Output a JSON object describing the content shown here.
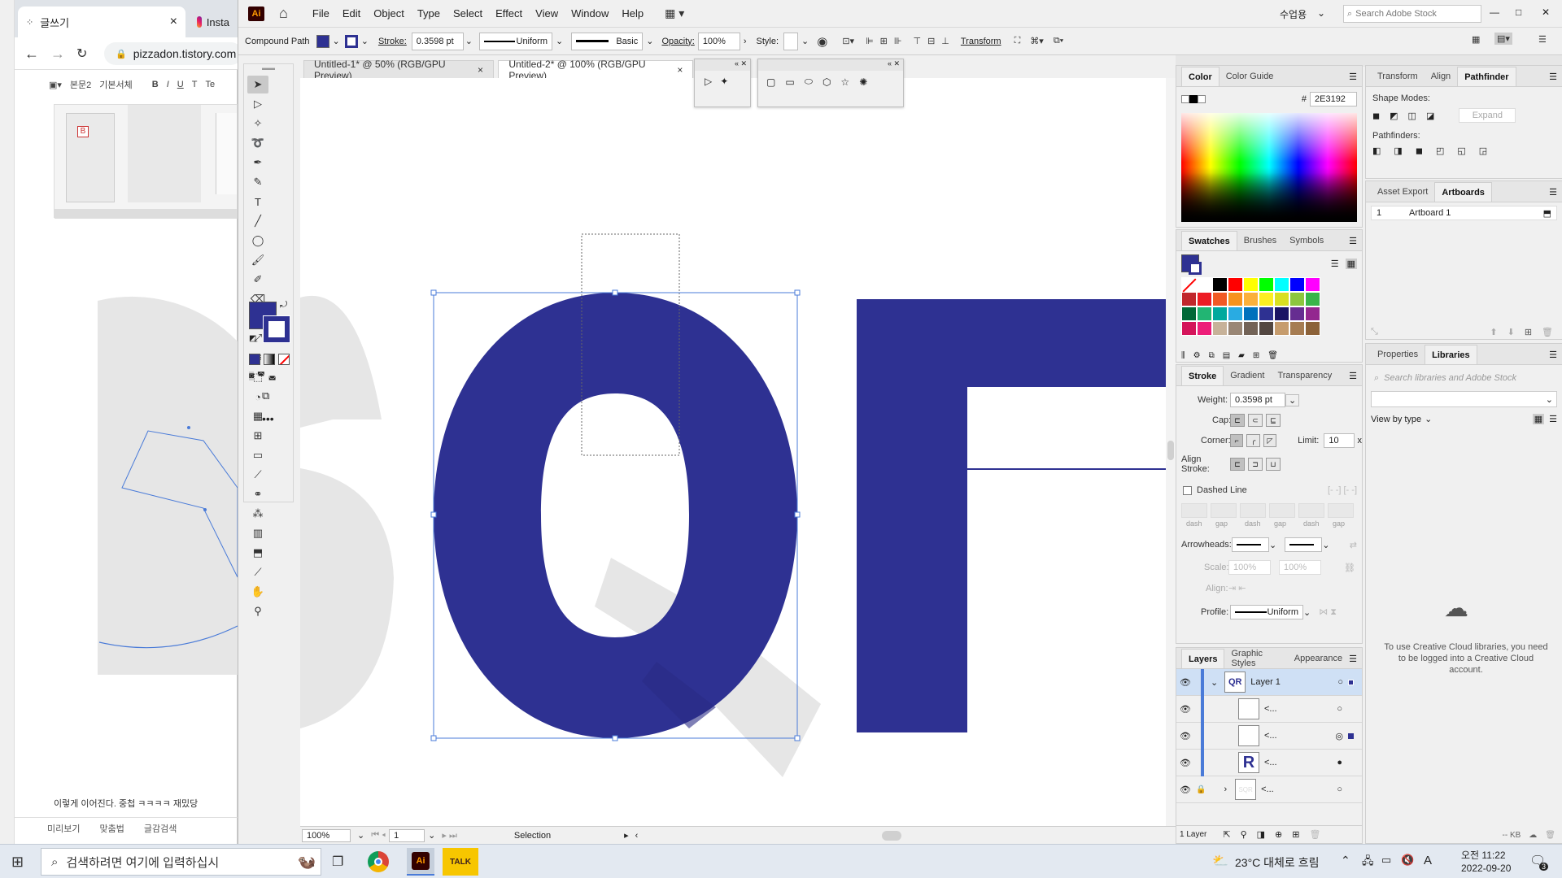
{
  "browser": {
    "tabs": [
      {
        "label": "글쓰기",
        "close": "×"
      },
      {
        "label": "Insta"
      }
    ],
    "url": "pizzadon.tistory.com",
    "editor_toolbar": [
      "본문2",
      "기본서체",
      "B",
      "I",
      "U",
      "T",
      "Te"
    ],
    "caption": "이렇게 이어진다. 중첩 ㅋㅋㅋㅋ 재밌당",
    "bottom_buttons": [
      "미리보기",
      "맞춤법",
      "글감검색"
    ]
  },
  "ai": {
    "logo": "Ai",
    "menu": [
      "File",
      "Edit",
      "Object",
      "Type",
      "Select",
      "Effect",
      "View",
      "Window",
      "Help"
    ],
    "user": "수업용",
    "stock_search_placeholder": "Search Adobe Stock",
    "window_controls": [
      "—",
      "□",
      "✕"
    ],
    "control": {
      "selection_type": "Compound Path",
      "stroke_label": "Stroke:",
      "stroke_weight": "0.3598 pt",
      "stroke_profile": "Uniform",
      "brush": "Basic",
      "opacity_label": "Opacity:",
      "opacity": "100%",
      "style_label": "Style:",
      "transform": "Transform"
    },
    "doc_tabs": [
      {
        "label": "Untitled-1* @ 50% (RGB/GPU Preview)",
        "active": false
      },
      {
        "label": "Untitled-2* @ 100% (RGB/GPU Preview)",
        "active": true
      }
    ],
    "fill_color": "#2E3192",
    "status": {
      "zoom": "100%",
      "artboard": "1",
      "tool": "Selection"
    }
  },
  "panels": {
    "color_tabs": [
      "Color",
      "Color Guide"
    ],
    "hex_label": "#",
    "hex": "2E3192",
    "swatch_tabs": [
      "Swatches",
      "Brushes",
      "Symbols"
    ],
    "swatches": [
      "#ffffff",
      "#ffffff",
      "#000000",
      "#ff0000",
      "#ffff00",
      "#00ff00",
      "#00ffff",
      "#0000ff",
      "#ff00ff",
      "#c1272d",
      "#ed1c24",
      "#f15a24",
      "#f7931e",
      "#fbb03b",
      "#fcee21",
      "#d9e021",
      "#8cc63f",
      "#39b54a",
      "#006837",
      "#22b573",
      "#00a99d",
      "#29abe2",
      "#0071bc",
      "#2e3192",
      "#1b1464",
      "#662d91",
      "#93278f",
      "#d4145a",
      "#ed1e79",
      "#c7b299",
      "#998675",
      "#736357",
      "#534741",
      "#c69c6d",
      "#a67c52",
      "#8c6239"
    ],
    "stroke_tabs": [
      "Stroke",
      "Gradient",
      "Transparency"
    ],
    "stroke": {
      "weight_label": "Weight:",
      "weight": "0.3598 pt",
      "cap_label": "Cap:",
      "corner_label": "Corner:",
      "limit_label": "Limit:",
      "limit": "10",
      "limit_x": "x",
      "align_label": "Align Stroke:",
      "dashed_label": "Dashed Line",
      "dash_labels": [
        "dash",
        "gap",
        "dash",
        "gap",
        "dash",
        "gap"
      ],
      "arrowheads_label": "Arrowheads:",
      "scale_label": "Scale:",
      "scale1": "100%",
      "scale2": "100%",
      "align2_label": "Align:",
      "profile_label": "Profile:",
      "profile": "Uniform"
    },
    "layers_tabs": [
      "Layers",
      "Graphic Styles",
      "Appearance"
    ],
    "layers": [
      {
        "name": "Layer 1",
        "thumb": "QR",
        "selected": true
      },
      {
        "name": "<...",
        "thumb": ""
      },
      {
        "name": "<...",
        "thumb": ""
      },
      {
        "name": "<...",
        "thumb": "R"
      },
      {
        "name": "<...",
        "thumb": "SQR"
      }
    ],
    "layers_count": "1 Layer",
    "transform_tabs": [
      "Transform",
      "Align",
      "Pathfinder"
    ],
    "shape_modes_label": "Shape Modes:",
    "expand": "Expand",
    "pathfinders_label": "Pathfinders:",
    "artboard_tabs": [
      "Asset Export",
      "Artboards"
    ],
    "artboard_row": {
      "num": "1",
      "name": "Artboard 1"
    },
    "lib_tabs": [
      "Properties",
      "Libraries"
    ],
    "lib_search_placeholder": "Search libraries and Adobe Stock",
    "view_by": "View by type",
    "lib_message": "To use Creative Cloud libraries, you need to be logged into a Creative Cloud account.",
    "lib_kb": "-- KB"
  },
  "taskbar": {
    "search_placeholder": "검색하려면 여기에 입력하십시",
    "weather": "23°C 대체로 흐림",
    "ime": "A",
    "time": "오전 11:22",
    "date": "2022-09-20",
    "notif_count": "3"
  }
}
